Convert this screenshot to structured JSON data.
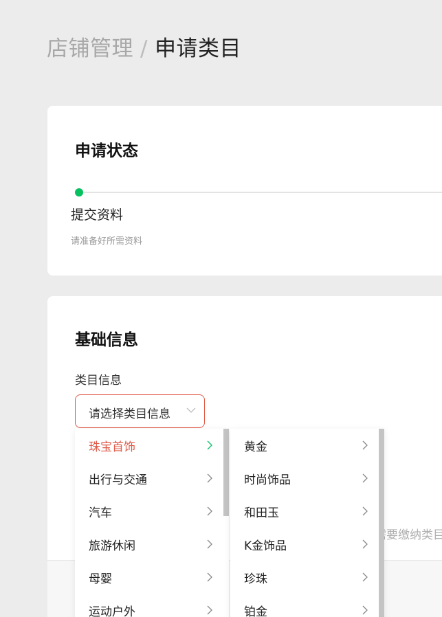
{
  "breadcrumb": {
    "parent": "店铺管理",
    "separator": "/",
    "current": "申请类目"
  },
  "status_card": {
    "title": "申请状态",
    "step": {
      "title": "提交资料",
      "description": "请准备好所需资料"
    }
  },
  "basic_card": {
    "title": "基础信息",
    "category_label": "类目信息",
    "select_placeholder": "请选择类目信息",
    "hint_fragment": "需要缴纳类目"
  },
  "dropdown": {
    "level1": [
      {
        "label": "珠宝首饰",
        "active": true
      },
      {
        "label": "出行与交通",
        "active": false
      },
      {
        "label": "汽车",
        "active": false
      },
      {
        "label": "旅游休闲",
        "active": false
      },
      {
        "label": "母婴",
        "active": false
      },
      {
        "label": "运动户外",
        "active": false
      }
    ],
    "level2": [
      {
        "label": "黄金"
      },
      {
        "label": "时尚饰品"
      },
      {
        "label": "和田玉"
      },
      {
        "label": "K金饰品"
      },
      {
        "label": "珍珠"
      },
      {
        "label": "铂金"
      }
    ]
  },
  "colors": {
    "accent": "#07c160",
    "error": "#e05a47",
    "active_text": "#e05a47"
  },
  "icons": {
    "select_arrow": "chevron-down-icon",
    "item_arrow": "chevron-right-icon"
  }
}
